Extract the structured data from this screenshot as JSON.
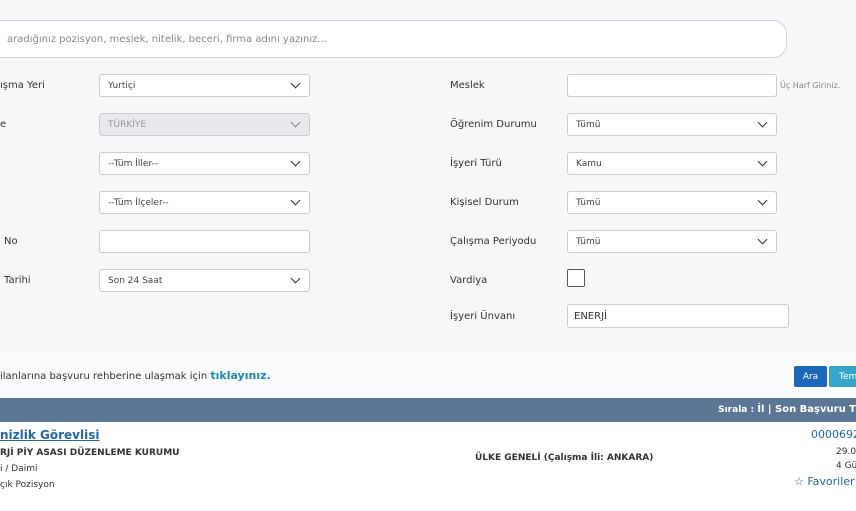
{
  "search": {
    "placeholder": "aradığınız pozisyon, meslek, nitelik, beceri, firma adını yazınız..."
  },
  "left_form": [
    {
      "label": "ışma Yeri",
      "value": "Yurtiçi"
    },
    {
      "label": "e",
      "value": "TÜRKİYE"
    },
    {
      "label": "",
      "value": "--Tüm İller--"
    },
    {
      "label": "",
      "value": "--Tüm İlçeler--"
    },
    {
      "label": "No",
      "value": ""
    },
    {
      "label": "Tarihi",
      "value": "Son 24 Saat"
    }
  ],
  "right_form": {
    "meslek": {
      "label": "Meslek",
      "value": "",
      "hint": "Üç Harf Giriniz."
    },
    "ogrenim": {
      "label": "Öğrenim Durumu",
      "value": "Tümü"
    },
    "isyeri_turu": {
      "label": "İşyeri Türü",
      "value": "Kamu"
    },
    "kisisel": {
      "label": "Kişisel Durum",
      "value": "Tümü"
    },
    "calisma_periyodu": {
      "label": "Çalışma Periyodu",
      "value": "Tümü"
    },
    "vardiya": {
      "label": "Vardiya"
    },
    "isyeri_unvani": {
      "label": "İşyeri Ünvanı",
      "value": "ENERJİ"
    }
  },
  "info": {
    "text": "ilanlarına başvuru rehberine ulaşmak için ",
    "link": "tıklayınız."
  },
  "buttons": {
    "ara": "Ara",
    "temizle": "Tem"
  },
  "sort": {
    "prefix": "Sırala : ",
    "item1": "İl",
    "sep": " | ",
    "item2": "Son Başvuru T"
  },
  "result": {
    "title": "nizlik Görevlisi",
    "company": "RJİ PİY ASASI DÜZENLEME KURUMU",
    "type": "i / Daimi",
    "positions": "çık Pozisyon",
    "location": "ÜLKE GENELİ (Çalışma İli: ANKARA)",
    "number": "0000692",
    "date": "29.0",
    "days": "4 Gü",
    "favorites": "☆ Favoriler"
  }
}
